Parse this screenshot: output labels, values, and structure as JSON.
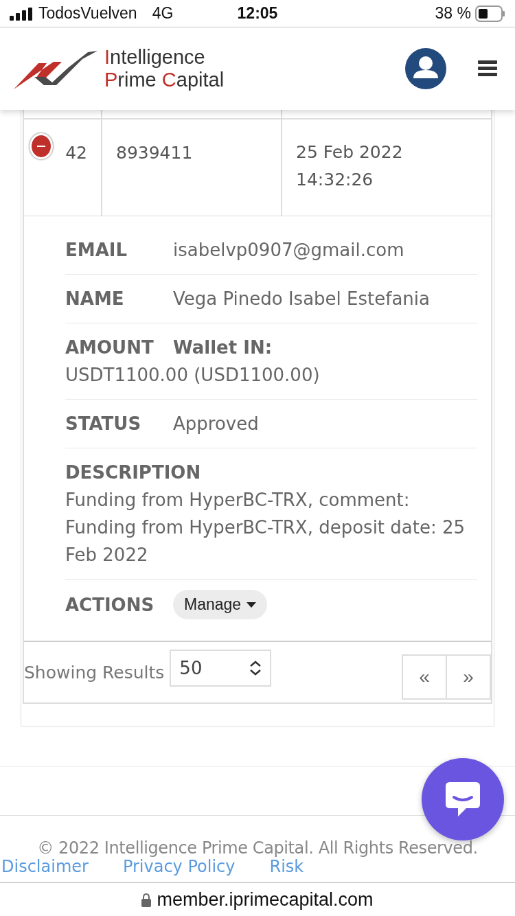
{
  "status_bar": {
    "carrier": "TodosVuelven",
    "network": "4G",
    "time": "12:05",
    "battery": "38 %"
  },
  "logo": {
    "lines": [
      [
        {
          "text": "I",
          "accent": true
        },
        {
          "text": "ntelligence",
          "accent": false
        }
      ],
      [
        {
          "text": "P",
          "accent": true
        },
        {
          "text": "rime ",
          "accent": false
        },
        {
          "text": "C",
          "accent": true
        },
        {
          "text": "apital",
          "accent": false
        }
      ]
    ]
  },
  "table": {
    "row": {
      "cells": [
        "42",
        "8939411",
        "25 Feb 2022 14:32:26"
      ],
      "expanded": true
    },
    "details": [
      {
        "kind": "inline",
        "label": "EMAIL",
        "value": "isabelvp0907@gmail.com"
      },
      {
        "kind": "inline",
        "label": "NAME",
        "value": "Vega Pinedo Isabel Estefania"
      },
      {
        "kind": "headed",
        "label": "AMOUNT",
        "heading": "Wallet IN:",
        "value": "USDT1100.00 (USD1100.00)"
      },
      {
        "kind": "inline",
        "label": "STATUS",
        "value": "Approved"
      },
      {
        "kind": "stacked",
        "label": "DESCRIPTION",
        "value": "Funding from HyperBC-TRX, comment: Funding from HyperBC-TRX, deposit date: 25 Feb 2022"
      },
      {
        "kind": "action",
        "label": "ACTIONS",
        "value": "Manage"
      }
    ]
  },
  "pagination": {
    "label": "Showing Results",
    "page_size": "50",
    "prev": "«",
    "next": "»"
  },
  "footer": {
    "copyright": "© 2022 Intelligence Prime Capital. All Rights Reserved.",
    "links": [
      "Disclaimer",
      "Privacy Policy",
      "Risk"
    ]
  },
  "url_bar": {
    "url": "member.iprimecapital.com"
  }
}
